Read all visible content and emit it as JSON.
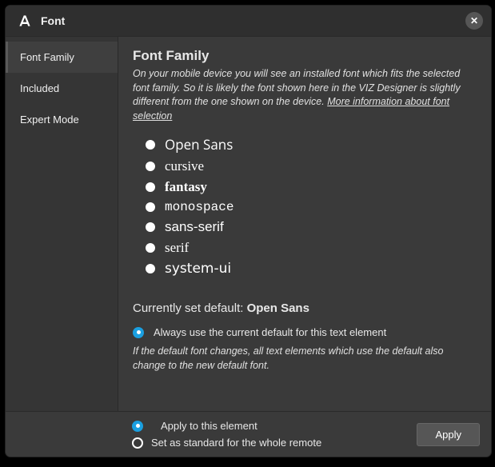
{
  "title": "Font",
  "tabs": [
    {
      "label": "Font Family",
      "active": true
    },
    {
      "label": "Included",
      "active": false
    },
    {
      "label": "Expert Mode",
      "active": false
    }
  ],
  "main": {
    "heading": "Font Family",
    "intro_before": "On your mobile device you will see an installed font which fits the selected font family. So it is likely the font shown here in the VIZ Designer is slightly different from the one shown on the device. ",
    "intro_link": "More information about font selection",
    "font_options": [
      {
        "label": "Open Sans",
        "css": "font-family:'Open Sans','Segoe UI',Arial,sans-serif;"
      },
      {
        "label": "cursive",
        "css": "font-family:'Brush Script MT','Segoe Script',cursive;"
      },
      {
        "label": "fantasy",
        "css": "font-family:Impact,fantasy;font-weight:700;"
      },
      {
        "label": "monospace",
        "css": "font-family:'Courier New',monospace;font-size:16px;"
      },
      {
        "label": "sans-serif",
        "css": "font-family:Arial,sans-serif;"
      },
      {
        "label": "serif",
        "css": "font-family:'Times New Roman',serif;"
      },
      {
        "label": "system-ui",
        "css": "font-family:system-ui,sans-serif;"
      }
    ],
    "current_prefix": "Currently set default: ",
    "current_value": "Open Sans",
    "always_default_label": "Always use the current default for this text element",
    "hint": "If the default font changes, all text elements which use the default also change to the new default font."
  },
  "footer": {
    "apply_this": "Apply to this element",
    "apply_all": "Set as standard for the whole remote",
    "apply_button": "Apply"
  }
}
